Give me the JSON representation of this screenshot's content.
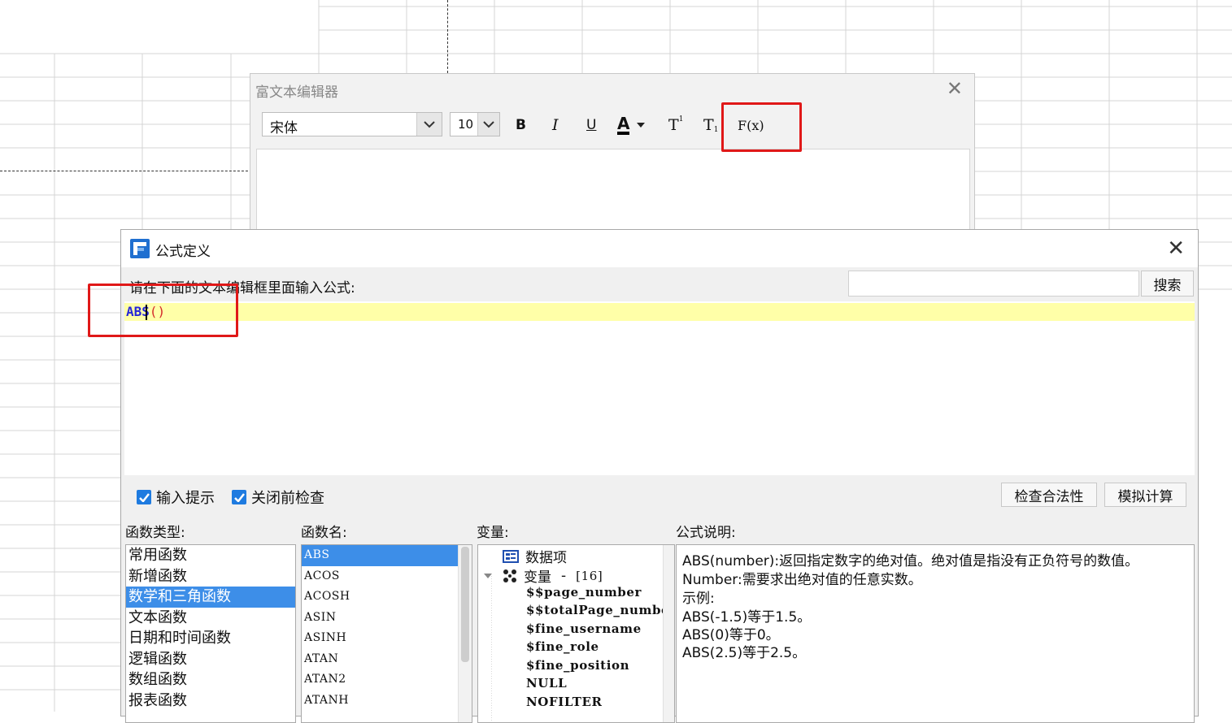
{
  "rich_text_editor": {
    "title": "富文本编辑器",
    "font_name": "宋体",
    "font_size": "10",
    "buttons": {
      "bold": "B",
      "italic": "I",
      "underline": "U",
      "font_color": "A",
      "superscript": "T",
      "subscript": "T",
      "formula": "F(x)"
    }
  },
  "formula_dialog": {
    "title": "公式定义",
    "prompt": "请在下面的文本编辑框里面输入公式:",
    "search_button": "搜索",
    "formula": {
      "name": "ABS",
      "parens": "()"
    },
    "options": {
      "input_hint": {
        "label": "输入提示",
        "checked": true
      },
      "check_before_close": {
        "label": "关闭前检查",
        "checked": true
      }
    },
    "buttons": {
      "validate": "检查合法性",
      "simulate": "模拟计算"
    },
    "labels": {
      "function_type": "函数类型:",
      "function_name": "函数名:",
      "variables": "变量:",
      "formula_description": "公式说明:"
    },
    "function_types": [
      "常用函数",
      "新增函数",
      "数学和三角函数",
      "文本函数",
      "日期和时间函数",
      "逻辑函数",
      "数组函数",
      "报表函数"
    ],
    "selected_function_type": "数学和三角函数",
    "function_names": [
      "ABS",
      "ACOS",
      "ACOSH",
      "ASIN",
      "ASINH",
      "ATAN",
      "ATAN2",
      "ATANH"
    ],
    "selected_function_name": "ABS",
    "variables_tree": {
      "data_items": "数据项",
      "variables_node": {
        "label": "变量",
        "dash": "-",
        "count": "[16]"
      },
      "children": [
        "$$page_number",
        "$$totalPage_number",
        "$fine_username",
        "$fine_role",
        "$fine_position",
        "NULL",
        "NOFILTER"
      ]
    },
    "description_lines": [
      "ABS(number):返回指定数字的绝对值。绝对值是指没有正负符号的数值。",
      "Number:需要求出绝对值的任意实数。",
      "示例:",
      "ABS(-1.5)等于1.5。",
      "ABS(0)等于0。",
      "ABS(2.5)等于2.5。"
    ]
  }
}
